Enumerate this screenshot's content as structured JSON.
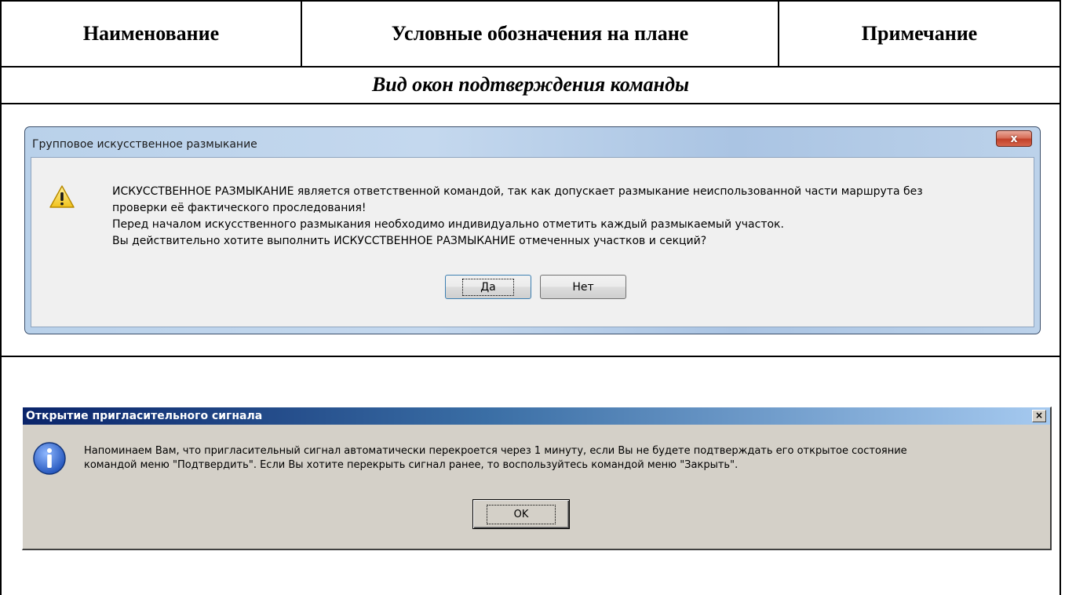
{
  "table": {
    "headers": [
      "Наименование",
      "Условные обозначения на плане",
      "Примечание"
    ],
    "section_title": "Вид окон подтверждения команды"
  },
  "dialog1": {
    "title": "Групповое искусственное размыкание",
    "close_glyph": "x",
    "icon": "warning-icon",
    "message_lines": [
      "ИСКУССТВЕННОЕ РАЗМЫКАНИЕ является ответственной командой, так как допускает размыкание неиспользованной части маршрута без",
      "проверки её фактического проследования!",
      "Перед началом искусственного размыкания необходимо индивидуально отметить каждый размыкаемый участок.",
      "Вы действительно хотите выполнить ИСКУССТВЕННОЕ РАЗМЫКАНИЕ отмеченных участков и секций?"
    ],
    "yes_label": "Да",
    "no_label": "Нет"
  },
  "dialog2": {
    "title": "Открытие пригласительного сигнала",
    "close_glyph": "×",
    "icon": "info-icon",
    "message_lines": [
      "Напоминаем Вам, что пригласительный сигнал автоматически перекроется через 1 минуту, если Вы не будете подтверждать его открытое состояние",
      "командой меню \"Подтвердить\". Если Вы хотите перекрыть сигнал ранее, то воспользуйтесь командой меню \"Закрыть\"."
    ],
    "ok_label": "OK"
  },
  "colors": {
    "win7_frame": "#b9d1ea",
    "classic_face": "#d4d0c8",
    "classic_title": "#0a246a"
  }
}
